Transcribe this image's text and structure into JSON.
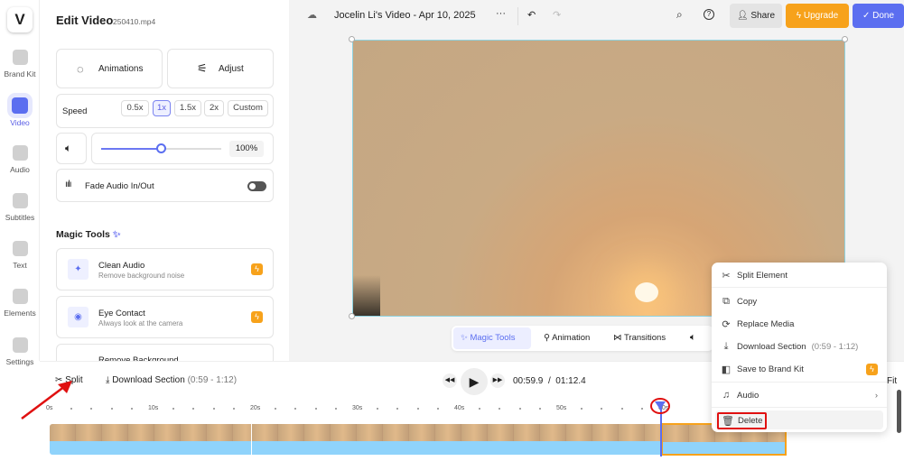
{
  "rail": {
    "logo": "V",
    "items": [
      "Brand Kit",
      "Video",
      "Audio",
      "Subtitles",
      "Text",
      "Elements",
      "Settings"
    ]
  },
  "panel": {
    "title": "Edit Video",
    "filename": "250410.mp4",
    "animations": "Animations",
    "adjust": "Adjust",
    "speed_label": "Speed",
    "speeds": [
      "0.5x",
      "1x",
      "1.5x",
      "2x",
      "Custom"
    ],
    "selected_speed": "1x",
    "volume": "100%",
    "volume_fraction": 0.5,
    "fade": "Fade Audio In/Out",
    "fade_on": false,
    "magic_title": "Magic Tools",
    "tools": [
      {
        "name": "Clean Audio",
        "desc": "Remove background noise"
      },
      {
        "name": "Eye Contact",
        "desc": "Always look at the camera"
      },
      {
        "name": "Remove Background",
        "desc": ""
      }
    ]
  },
  "header": {
    "title": "Jocelin Li's Video - Apr 10, 2025",
    "more": "···",
    "share": "Share",
    "upgrade": "Upgrade",
    "done": "Done"
  },
  "toolbar": {
    "magic": "Magic Tools",
    "animation": "Animation",
    "transitions": "Transitions"
  },
  "timeline": {
    "split": "Split",
    "download": "Download Section",
    "range": "(0:59 - 1:12)",
    "current": "00:59.9",
    "sep": "/",
    "total": "01:12.4",
    "fit": "Fit",
    "ticks": [
      "0s",
      "10s",
      "20s",
      "30s",
      "40s",
      "50s",
      "60s"
    ]
  },
  "menu": {
    "split": "Split Element",
    "copy": "Copy",
    "replace": "Replace Media",
    "download": "Download Section",
    "range": "(0:59 - 1:12)",
    "save": "Save to Brand Kit",
    "audio": "Audio",
    "delete": "Delete"
  },
  "colors": {
    "accent": "#5b6ef0",
    "upgrade": "#f7a21b",
    "annotation": "#e01010"
  }
}
